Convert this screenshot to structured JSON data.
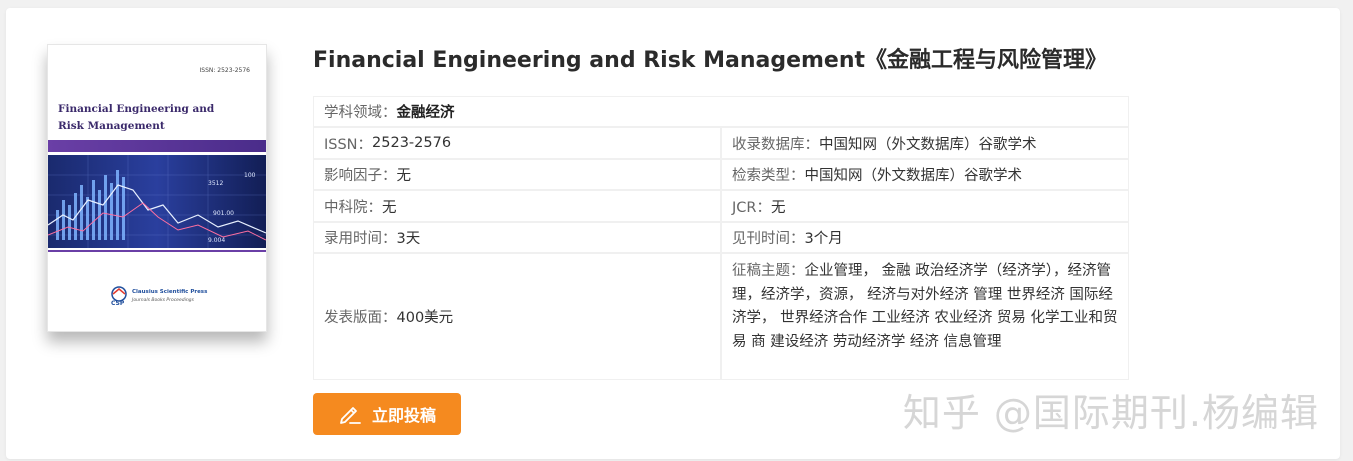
{
  "journal": {
    "title": "Financial Engineering and Risk Management《金融工程与风险管理》"
  },
  "cover": {
    "issn": "ISSN: 2523-2576",
    "title": "Financial Engineering and Risk Management",
    "title_line1": "Financial Engineering and",
    "title_line2": "Risk Management",
    "publisher": "Clausius Scientific Press",
    "publisher_sub": "Journals Books Proceedings",
    "logo_text": "CSP",
    "chart_labels": [
      "3512",
      "100",
      "901.00",
      "9.004"
    ]
  },
  "info": {
    "field_label": "学科领域：",
    "field_value": "金融经济",
    "issn_label": "ISSN：",
    "issn_value": "2523-2576",
    "database_label": "收录数据库：",
    "database_value": "中国知网（外文数据库）谷歌学术",
    "impact_label": "影响因子：",
    "impact_value": "无",
    "search_label": "检索类型：",
    "search_value": "中国知网（外文数据库）谷歌学术",
    "cas_label": "中科院：",
    "cas_value": "无",
    "jcr_label": "JCR：",
    "jcr_value": "无",
    "accept_label": "录用时间：",
    "accept_value": "3天",
    "publish_label": "见刊时间：",
    "publish_value": "3个月",
    "fee_label": "发表版面：",
    "fee_value": "400美元",
    "topics_label": "征稿主题：",
    "topics_value": "企业管理， 金融 政治经济学（经济学），经济管理，经济学，资源， 经济与对外经济 管理 世界经济 国际经济学， 世界经济合作 工业经济 农业经济 贸易 化学工业和贸易 商 建设经济 劳动经济学 经济 信息管理"
  },
  "actions": {
    "submit_label": "立即投稿"
  },
  "watermark": {
    "text": "知乎 @国际期刊.杨编辑"
  },
  "colors": {
    "accent": "#f58a1f",
    "cover_purple": "#6a3fa6"
  }
}
